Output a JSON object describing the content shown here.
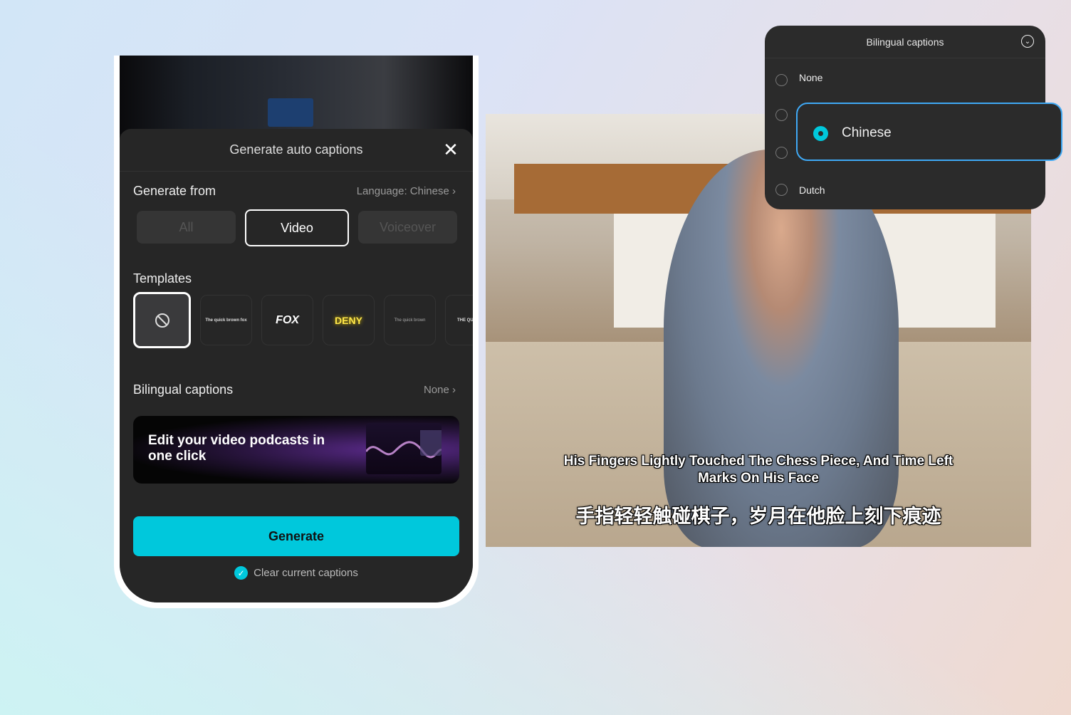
{
  "panel": {
    "title": "Generate auto captions",
    "generate_from": {
      "label": "Generate from",
      "language": "Language: Chinese"
    },
    "sources": [
      "All",
      "Video",
      "Voiceover"
    ],
    "selected_source": "Video",
    "templates": {
      "label": "Templates",
      "items": [
        "none",
        "The quick brown fox",
        "FOX",
        "DENY",
        "The quick brown",
        "THE QUICK B"
      ]
    },
    "bilingual": {
      "label": "Bilingual captions",
      "value": "None"
    },
    "banner": {
      "text": "Edit your video podcasts in one click"
    },
    "generate_label": "Generate",
    "clear_label": "Clear current captions",
    "clear_checked": true,
    "accent": "#00c8dc"
  },
  "preview": {
    "subtitle_en": "His Fingers Lightly Touched The Chess Piece, And Time Left Marks On His Face",
    "subtitle_zh": "手指轻轻触碰棋子，岁月在他脸上刻下痕迹"
  },
  "dropdown": {
    "title": "Bilingual captions",
    "options": [
      "None",
      "Chinese",
      "Dutch"
    ],
    "selected": "Chinese"
  }
}
